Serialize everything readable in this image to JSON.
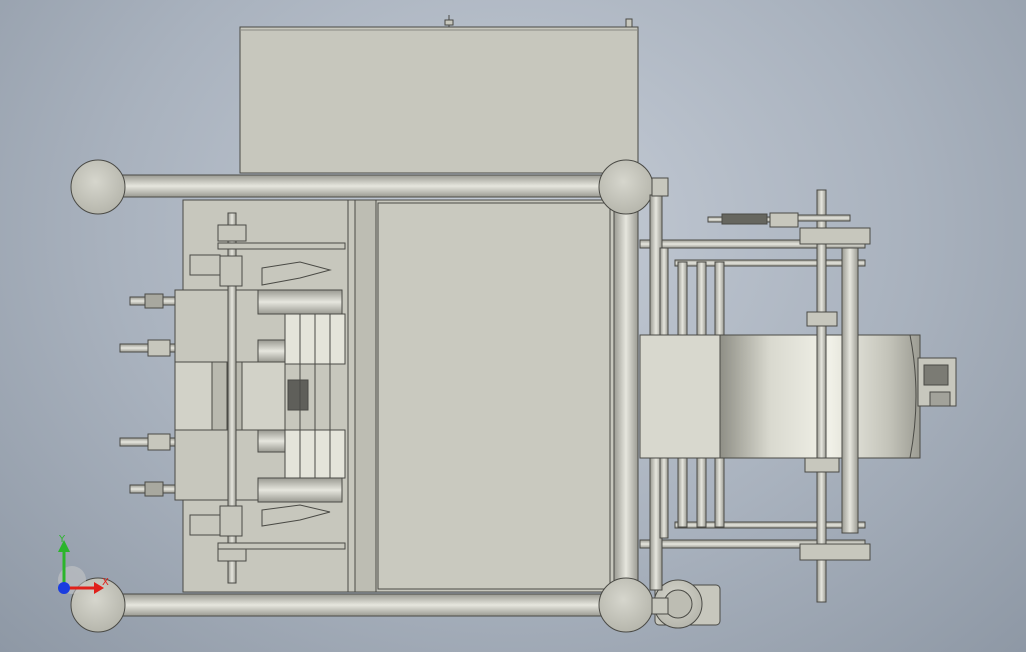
{
  "viewport": {
    "background_top": "#c5ccd6",
    "background_bottom": "#8e98a5",
    "part_color": "#c7c7bd",
    "edge_color": "#4a4a45"
  },
  "triad": {
    "x_label": "X",
    "y_label": "Y",
    "x_color": "#e0201a",
    "y_color": "#2bb52b",
    "z_color": "#1a3de0"
  }
}
